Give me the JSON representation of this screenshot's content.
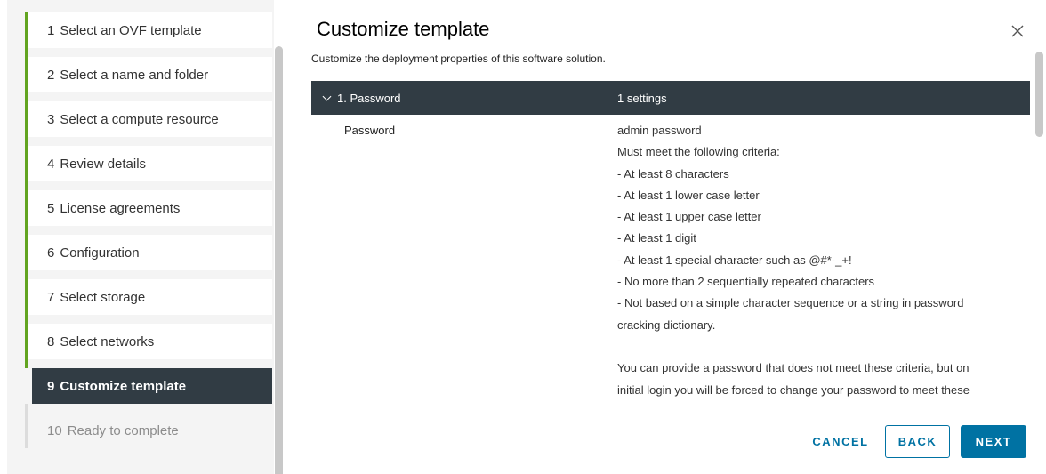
{
  "wizard": {
    "steps": [
      {
        "num": "1",
        "label": "Select an OVF template"
      },
      {
        "num": "2",
        "label": "Select a name and folder"
      },
      {
        "num": "3",
        "label": "Select a compute resource"
      },
      {
        "num": "4",
        "label": "Review details"
      },
      {
        "num": "5",
        "label": "License agreements"
      },
      {
        "num": "6",
        "label": "Configuration"
      },
      {
        "num": "7",
        "label": "Select storage"
      },
      {
        "num": "8",
        "label": "Select networks"
      },
      {
        "num": "9",
        "label": "Customize template"
      },
      {
        "num": "10",
        "label": "Ready to complete"
      }
    ],
    "current_step": "9"
  },
  "main": {
    "title": "Customize template",
    "subtitle": "Customize the deployment properties of this software solution.",
    "group": {
      "name": "1. Password",
      "count": "1 settings"
    },
    "property": {
      "label": "Password",
      "description_lines": [
        "admin password",
        "Must meet the following criteria:",
        "- At least 8 characters",
        "- At least 1 lower case letter",
        "- At least 1 upper case letter",
        "- At least 1 digit",
        "- At least 1 special character such as @#*-_+!",
        "- No more than 2 sequentially repeated characters",
        "- Not based on a simple character sequence or a string in password",
        "cracking dictionary.",
        "",
        "You can provide a password that does not meet these criteria, but on",
        "initial login you will be forced to change your password to meet these"
      ]
    }
  },
  "buttons": {
    "cancel": "CANCEL",
    "back": "BACK",
    "next": "NEXT"
  },
  "colors": {
    "accent": "#0072a3",
    "header_dark": "#313c44",
    "progress_green": "#62a420"
  }
}
